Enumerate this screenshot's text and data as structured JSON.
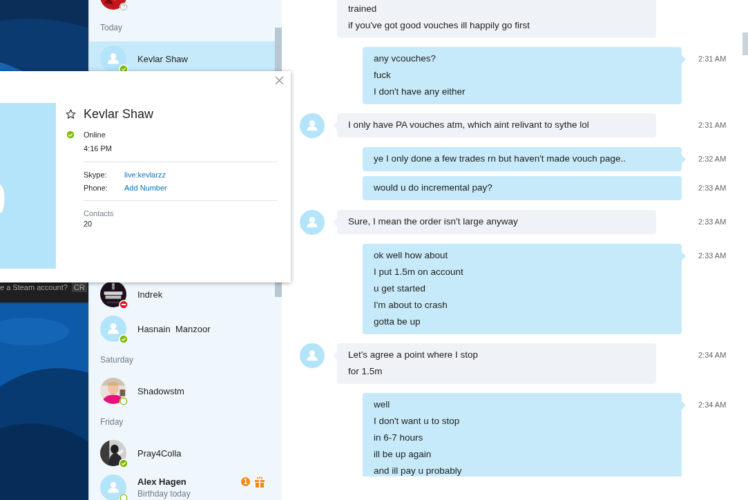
{
  "background_window": {
    "text": "e a Steam account?",
    "button": "CR"
  },
  "sidebar": {
    "items": [
      {
        "kind": "contact",
        "status": {
          "kind": "unknown"
        },
        "selected": false
      },
      {
        "kind": "header",
        "label": "Today"
      },
      {
        "kind": "contact",
        "name": "Kevlar Shaw",
        "avatar": {
          "kind": "default"
        },
        "status": {
          "kind": "online"
        },
        "selected": true
      },
      {
        "kind": "contact",
        "name": "Indrek",
        "status": {
          "kind": "busy"
        },
        "selected": false
      },
      {
        "kind": "contact",
        "name": "Hasnain  Manzoor",
        "avatar": {
          "kind": "default"
        },
        "status": {
          "kind": "online"
        },
        "selected": false
      },
      {
        "kind": "header",
        "label": "Saturday"
      },
      {
        "kind": "contact",
        "name": "Shadowstm",
        "status": {
          "kind": "offline"
        },
        "selected": false
      },
      {
        "kind": "header",
        "label": "Friday"
      },
      {
        "kind": "contact",
        "name": "Pray4Colla",
        "status": {
          "kind": "online"
        },
        "selected": false
      },
      {
        "kind": "contact",
        "name": "Alex Hagen",
        "subtitle": "Birthday today",
        "unread": "1",
        "gift": true,
        "avatar": {
          "kind": "default"
        },
        "status": {
          "kind": "offline"
        },
        "selected": false
      }
    ]
  },
  "chat": {
    "messages": [
      {
        "kind": "incoming",
        "avatar": false,
        "tail": false,
        "lines": [
          "trained",
          "if you've got good vouches ill happily go first"
        ]
      },
      {
        "kind": "outgoing",
        "tail": true,
        "time": "2:31 AM",
        "lines": [
          "any vcouches?",
          "fuck",
          "I don't have any either"
        ]
      },
      {
        "kind": "incoming",
        "avatar": true,
        "tail": true,
        "time": "2:31 AM",
        "lines": [
          "I only have PA vouches atm, which aint relivant to sythe lol"
        ]
      },
      {
        "kind": "outgoing",
        "tail": true,
        "time": "2:32 AM",
        "lines": [
          "ye I only done a few trades rn but haven't made vouch page.."
        ]
      },
      {
        "kind": "outgoing",
        "tail": false,
        "time": "2:33 AM",
        "lines": [
          "would u do incremental pay?"
        ]
      },
      {
        "kind": "incoming",
        "avatar": true,
        "tail": true,
        "time": "2:33 AM",
        "lines": [
          "Sure, I mean the order isn't large anyway"
        ]
      },
      {
        "kind": "outgoing",
        "tail": true,
        "time": "2:33 AM",
        "lines": [
          "ok well how about",
          "I put 1.5m on account",
          "u get started",
          "I'm about to crash",
          "gotta be up"
        ]
      },
      {
        "kind": "incoming",
        "avatar": true,
        "tail": true,
        "time": "2:34 AM",
        "lines": [
          "Let's agree a point where I stop",
          "for 1.5m"
        ]
      },
      {
        "kind": "outgoing",
        "tail": true,
        "time": "2:34 AM",
        "lines": [
          "well",
          "I don't want u to stop",
          "in 6-7 hours",
          "ill be up again",
          "and ill pay u probably"
        ]
      }
    ]
  },
  "profile_card": {
    "name": "Kevlar Shaw",
    "favorite": false,
    "status": {
      "kind": "online"
    },
    "status_label": "Online",
    "local_time": "4:16 PM",
    "fields": [
      {
        "label": "Skype:",
        "value": "live:kevlarzz",
        "kind": "link"
      },
      {
        "label": "Phone:",
        "value": "Add Number",
        "kind": "link"
      }
    ],
    "contacts_label": "Contacts",
    "contacts_count": "20"
  }
}
